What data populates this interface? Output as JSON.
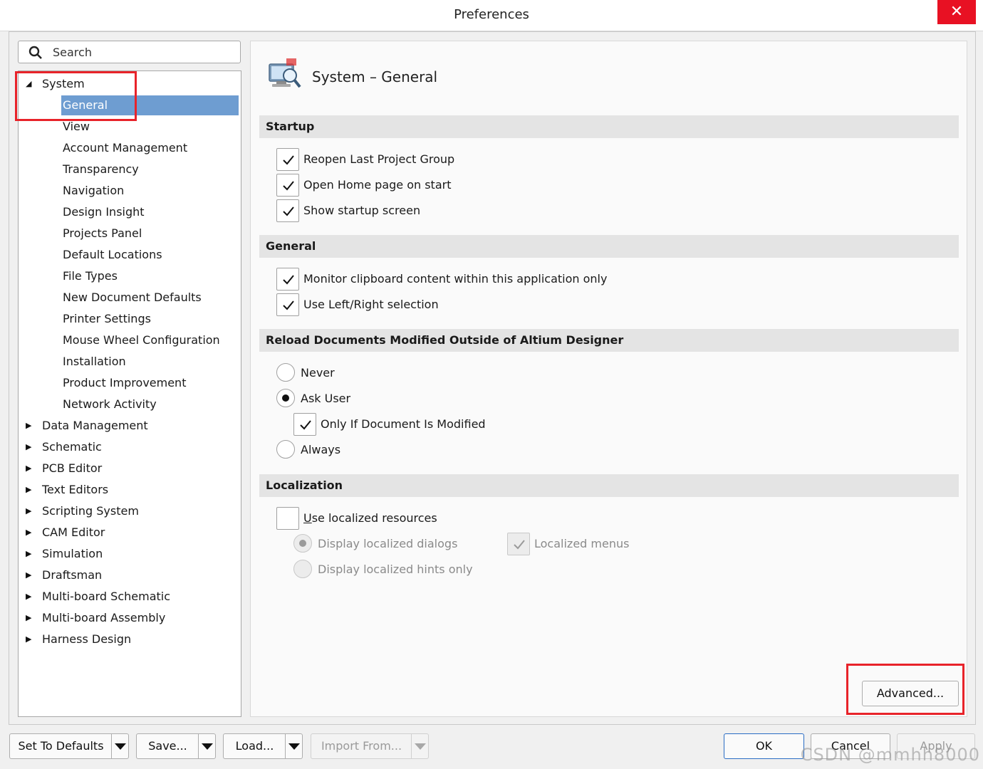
{
  "window": {
    "title": "Preferences",
    "close_glyph": "✕"
  },
  "search": {
    "placeholder": "Search",
    "icon": "search-icon"
  },
  "tree": {
    "system_label": "System",
    "system_children": [
      "General",
      "View",
      "Account Management",
      "Transparency",
      "Navigation",
      "Design Insight",
      "Projects Panel",
      "Default Locations",
      "File Types",
      "New Document Defaults",
      "Printer Settings",
      "Mouse Wheel Configuration",
      "Installation",
      "Product Improvement",
      "Network Activity"
    ],
    "collapsed_roots": [
      "Data Management",
      "Schematic",
      "PCB Editor",
      "Text Editors",
      "Scripting System",
      "CAM Editor",
      "Simulation",
      "Draftsman",
      "Multi-board Schematic",
      "Multi-board Assembly",
      "Harness Design"
    ],
    "selected": "General"
  },
  "page": {
    "title": "System – General",
    "icon": "system-monitor-icon",
    "startup": {
      "header": "Startup",
      "reopen_last": {
        "label": "Reopen Last Project Group",
        "checked": true
      },
      "open_home": {
        "label": "Open Home page on start",
        "checked": true
      },
      "show_startup": {
        "label": "Show startup screen",
        "checked": true
      }
    },
    "general": {
      "header": "General",
      "monitor_clipboard": {
        "label": "Monitor clipboard content within this application only",
        "checked": true
      },
      "left_right": {
        "label": "Use Left/Right selection",
        "checked": true
      }
    },
    "reload": {
      "header": "Reload Documents Modified Outside of Altium Designer",
      "never": "Never",
      "ask_user": "Ask User",
      "only_if_modified": {
        "label": "Only If Document Is Modified",
        "checked": true
      },
      "always": "Always",
      "selected": "Ask User"
    },
    "localization": {
      "header": "Localization",
      "use_localized_prefix": "U",
      "use_localized_rest": "se localized resources",
      "use_localized_checked": false,
      "display_dialogs": "Display localized dialogs",
      "display_hints": "Display localized hints only",
      "localized_menus": "Localized menus"
    },
    "advanced_button": "Advanced..."
  },
  "footer": {
    "set_to_defaults": "Set To Defaults",
    "save": "Save...",
    "load": "Load...",
    "import_from": "Import From...",
    "ok": "OK",
    "cancel": "Cancel",
    "apply": "Apply"
  },
  "watermark": "CSDN @mmhh8000",
  "colors": {
    "selection": "#6e9dd1",
    "highlight_box": "#e8232a",
    "close": "#e81123",
    "ok_border": "#2a6cc4"
  }
}
